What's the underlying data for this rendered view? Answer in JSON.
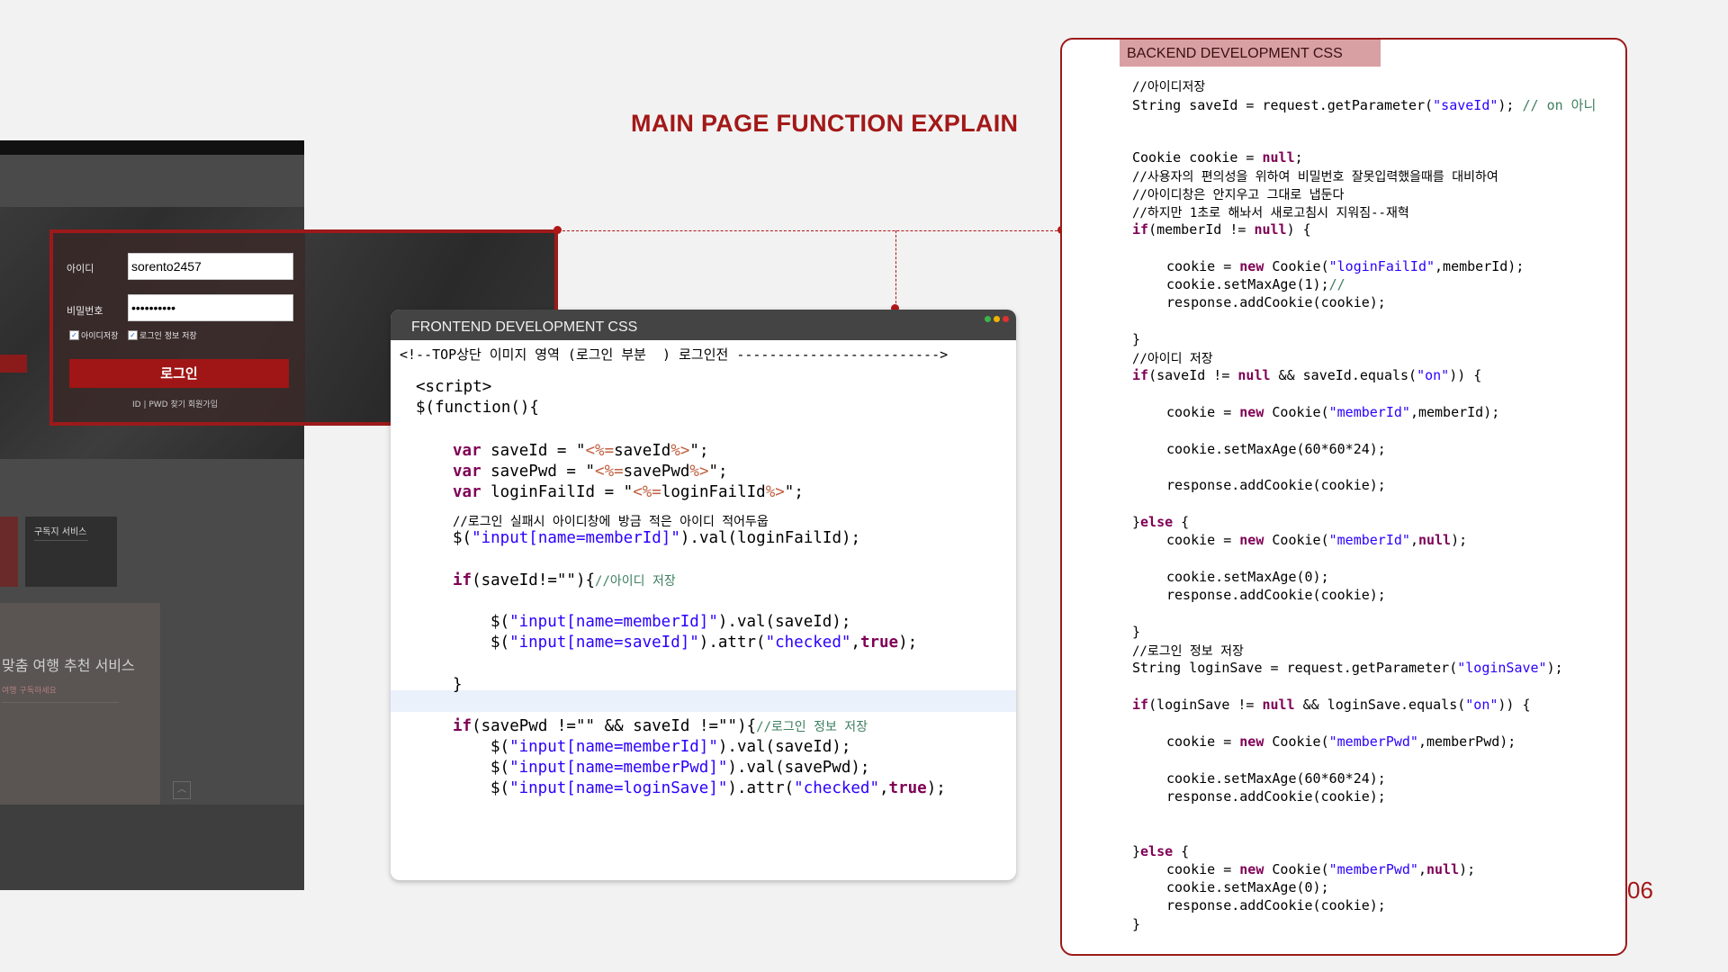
{
  "slide": {
    "title": "MAIN PAGE FUNCTION EXPLAIN",
    "page_number": "06",
    "accent_color": "#a31818"
  },
  "website": {
    "service_card_title": "구독지 서비스",
    "panel_title": "맞춤 여행 추천 서비스",
    "panel_subtitle": "여행 구독하세요"
  },
  "login": {
    "id_label": "아이디",
    "id_value": "sorento2457",
    "pw_label": "비밀번호",
    "pw_value": "••••••••••",
    "save_id_label": "아이디저장",
    "save_login_label": "로그인 정보 저장",
    "submit_label": "로그인",
    "links": "ID | PWD 찾기  회원가입"
  },
  "frontend": {
    "title": "FRONTEND DEVELOPMENT  CSS",
    "code": {
      "l1": "<!--TOP상단 이미지 영역 (로그인 부분  ) 로그인전 ------------------------->",
      "l2": "<script>",
      "l3": "$(function(){",
      "l4a": "var",
      "l4b": " saveId = \"",
      "l4c": "<%=",
      "l4d": "saveId",
      "l4e": "%>",
      "l4f": "\";",
      "l5a": "var",
      "l5b": " savePwd = \"",
      "l5c": "<%=",
      "l5d": "savePwd",
      "l5e": "%>",
      "l5f": "\";",
      "l6a": "var",
      "l6b": " loginFailId = \"",
      "l6c": "<%=",
      "l6d": "loginFailId",
      "l6e": "%>",
      "l6f": "\";",
      "l7": "//로그인 실패시 아이디창에 방금 적은 아이디 적어두웁",
      "l8a": "$(",
      "l8b": "\"input[name=memberId]\"",
      "l8c": ").val(loginFailId);",
      "l9a": "if",
      "l9b": "(saveId!=\"\"){",
      "l9c": "//아이디 저장",
      "l10a": "$(",
      "l10b": "\"input[name=memberId]\"",
      "l10c": ").val(saveId);",
      "l11a": "$(",
      "l11b": "\"input[name=saveId]\"",
      "l11c": ").attr(",
      "l11d": "\"checked\"",
      "l11e": ",",
      "l11f": "true",
      "l11g": ");",
      "l12": "}",
      "l13a": "if",
      "l13b": "(savePwd !=\"\" && saveId !=\"\"){",
      "l13c": "//로그인 정보 저장",
      "l14a": "$(",
      "l14b": "\"input[name=memberId]\"",
      "l14c": ").val(saveId);",
      "l15a": "$(",
      "l15b": "\"input[name=memberPwd]\"",
      "l15c": ").val(savePwd);",
      "l16a": "$(",
      "l16b": "\"input[name=loginSave]\"",
      "l16c": ").attr(",
      "l16d": "\"checked\"",
      "l16e": ",",
      "l16f": "true",
      "l16g": ");"
    }
  },
  "backend": {
    "title": "BACKEND DEVELOPMENT  CSS",
    "code": {
      "b1": "//아이디저장",
      "b2a": "String saveId = request.getParameter(",
      "b2b": "\"saveId\"",
      "b2c": "); ",
      "b2d": "// on 아니",
      "b3a": "Cookie cookie = ",
      "b3b": "null",
      "b3c": ";",
      "b4": "//사용자의 편의성을 위하여 비밀번호 잘못입력했을때를 대비하여",
      "b5": "//아이디창은 안지우고 그대로 냅둔다",
      "b6": "//하지만 1초로 해놔서 새로고침시 지워짐--재혁",
      "b7a": "if",
      "b7b": "(memberId != ",
      "b7c": "null",
      "b7d": ") {",
      "b8a": "cookie = ",
      "b8b": "new",
      "b8c": " Cookie(",
      "b8d": "\"loginFailId\"",
      "b8e": ",memberId);",
      "b9a": "cookie.setMaxAge(1);",
      "b9b": "//",
      "b10": "response.addCookie(cookie);",
      "b11": "}",
      "b12": "//아이디 저장",
      "b13a": "if",
      "b13b": "(saveId != ",
      "b13c": "null",
      "b13d": " && saveId.equals(",
      "b13e": "\"on\"",
      "b13f": ")) {",
      "b14a": "cookie = ",
      "b14b": "new",
      "b14c": " Cookie(",
      "b14d": "\"memberId\"",
      "b14e": ",memberId);",
      "b15": "cookie.setMaxAge(60*60*24);",
      "b16": "response.addCookie(cookie);",
      "b17a": "}",
      "b17b": "else",
      "b17c": " {",
      "b18a": "cookie = ",
      "b18b": "new",
      "b18c": " Cookie(",
      "b18d": "\"memberId\"",
      "b18e": ",",
      "b18f": "null",
      "b18g": ");",
      "b19": "cookie.setMaxAge(0);",
      "b20": "response.addCookie(cookie);",
      "b21": "}",
      "b22": "//로그인 정보 저장",
      "b23a": "String loginSave = request.getParameter(",
      "b23b": "\"loginSave\"",
      "b23c": ");",
      "b24a": "if",
      "b24b": "(loginSave != ",
      "b24c": "null",
      "b24d": " && loginSave.equals(",
      "b24e": "\"on\"",
      "b24f": ")) {",
      "b25a": "cookie = ",
      "b25b": "new",
      "b25c": " Cookie(",
      "b25d": "\"memberPwd\"",
      "b25e": ",memberPwd);",
      "b26": "cookie.setMaxAge(60*60*24);",
      "b27": "response.addCookie(cookie);",
      "b28a": "}",
      "b28b": "else",
      "b28c": " {",
      "b29a": "cookie = ",
      "b29b": "new",
      "b29c": " Cookie(",
      "b29d": "\"memberPwd\"",
      "b29e": ",",
      "b29f": "null",
      "b29g": ");",
      "b30": "cookie.setMaxAge(0);",
      "b31": "response.addCookie(cookie);",
      "b32": "}"
    }
  }
}
